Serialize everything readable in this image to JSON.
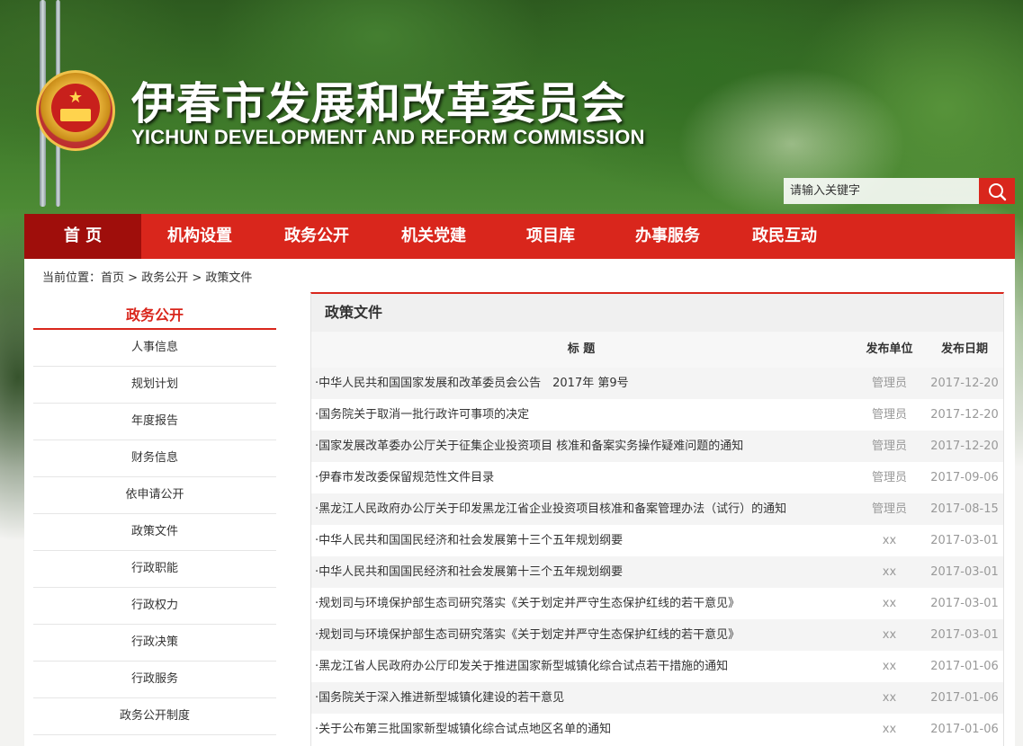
{
  "header": {
    "title_cn": "伊春市发展和改革委员会",
    "title_en": "YICHUN DEVELOPMENT AND REFORM COMMISSION"
  },
  "search": {
    "placeholder": "请输入关键字",
    "icon": "search-icon"
  },
  "nav": [
    "首 页",
    "机构设置",
    "政务公开",
    "机关党建",
    "项目库",
    "办事服务",
    "政民互动"
  ],
  "nav_active": "首 页",
  "breadcrumb": {
    "prefix": "当前位置：",
    "items": [
      "首页",
      "政务公开",
      "政策文件"
    ],
    "separator": " > "
  },
  "sidebar": {
    "heading": "政务公开",
    "items": [
      "人事信息",
      "规划计划",
      "年度报告",
      "财务信息",
      "依申请公开",
      "政策文件",
      "行政职能",
      "行政权力",
      "行政决策",
      "行政服务",
      "政务公开制度"
    ]
  },
  "main": {
    "title": "政策文件",
    "columns": {
      "title": "标 题",
      "unit": "发布单位",
      "date": "发布日期"
    },
    "rows": [
      {
        "title": "·中华人民共和国国家发展和改革委员会公告　2017年 第9号",
        "unit": "管理员",
        "date": "2017-12-20"
      },
      {
        "title": "·国务院关于取消一批行政许可事项的决定",
        "unit": "管理员",
        "date": "2017-12-20"
      },
      {
        "title": "·国家发展改革委办公厅关于征集企业投资项目 核准和备案实务操作疑难问题的通知",
        "unit": "管理员",
        "date": "2017-12-20"
      },
      {
        "title": "·伊春市发改委保留规范性文件目录",
        "unit": "管理员",
        "date": "2017-09-06"
      },
      {
        "title": "·黑龙江人民政府办公厅关于印发黑龙江省企业投资项目核准和备案管理办法（试行）的通知",
        "unit": "管理员",
        "date": "2017-08-15"
      },
      {
        "title": "·中华人民共和国国民经济和社会发展第十三个五年规划纲要",
        "unit": "xx",
        "date": "2017-03-01"
      },
      {
        "title": "·中华人民共和国国民经济和社会发展第十三个五年规划纲要",
        "unit": "xx",
        "date": "2017-03-01"
      },
      {
        "title": "·规划司与环境保护部生态司研究落实《关于划定并严守生态保护红线的若干意见》",
        "unit": "xx",
        "date": "2017-03-01"
      },
      {
        "title": "·规划司与环境保护部生态司研究落实《关于划定并严守生态保护红线的若干意见》",
        "unit": "xx",
        "date": "2017-03-01"
      },
      {
        "title": "·黑龙江省人民政府办公厅印发关于推进国家新型城镇化综合试点若干措施的通知",
        "unit": "xx",
        "date": "2017-01-06"
      },
      {
        "title": "·国务院关于深入推进新型城镇化建设的若干意见",
        "unit": "xx",
        "date": "2017-01-06"
      },
      {
        "title": "·关于公布第三批国家新型城镇化综合试点地区名单的通知",
        "unit": "xx",
        "date": "2017-01-06"
      }
    ]
  },
  "colors": {
    "accent": "#d9261c",
    "nav_active": "#9f0e0b"
  }
}
